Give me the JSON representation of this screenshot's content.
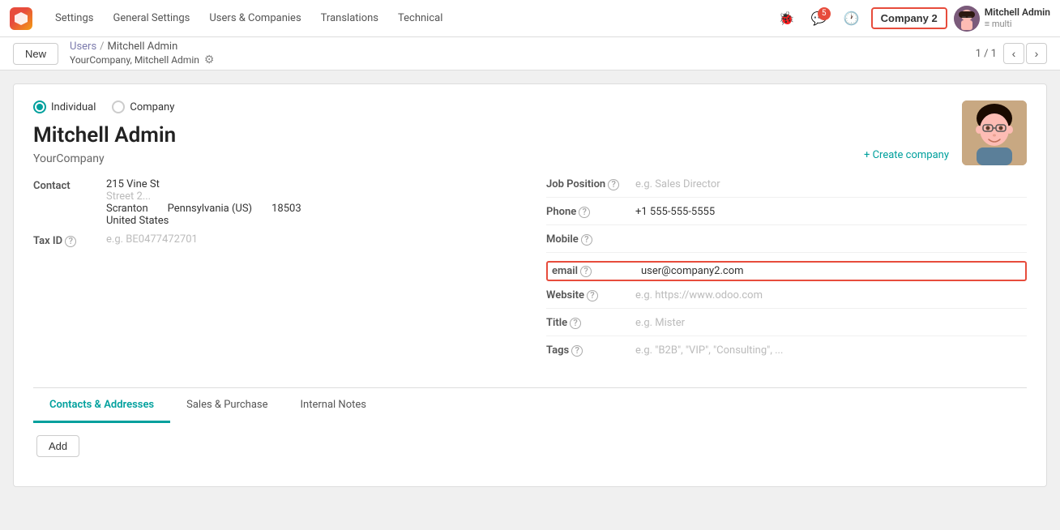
{
  "topbar": {
    "logo": "⬡",
    "nav_items": [
      "Settings",
      "General Settings",
      "Users & Companies",
      "Translations",
      "Technical"
    ],
    "icons": {
      "bug": "🐞",
      "chat_badge": "5",
      "clock": "🕐"
    },
    "company_label": "Company 2",
    "user_name": "Mitchell Admin",
    "user_sub": "≡ multi"
  },
  "breadcrumb": {
    "parent": "Users",
    "current": "Mitchell Admin",
    "subtitle": "YourCompany, Mitchell Admin",
    "pagination": "1 / 1"
  },
  "new_button": "New",
  "form": {
    "radio_individual": "Individual",
    "radio_company": "Company",
    "contact_name": "Mitchell Admin",
    "company_name": "YourCompany",
    "create_company": "+ Create company",
    "contact_label": "Contact",
    "address_line1": "215 Vine St",
    "address_line2_placeholder": "Street 2...",
    "address_city": "Scranton",
    "address_state": "Pennsylvania (US)",
    "address_zip": "18503",
    "address_country": "United States",
    "tax_id_label": "Tax ID",
    "tax_id_placeholder": "e.g. BE0477472701",
    "right_fields": [
      {
        "label": "Job Position",
        "value": "",
        "placeholder": "e.g. Sales Director",
        "has_help": true
      },
      {
        "label": "Phone",
        "value": "+1 555-555-5555",
        "placeholder": "",
        "has_help": true
      },
      {
        "label": "Mobile",
        "value": "",
        "placeholder": "",
        "has_help": true
      },
      {
        "label": "email",
        "value": "user@company2.com",
        "placeholder": "",
        "has_help": true,
        "highlighted": true
      },
      {
        "label": "Website",
        "value": "",
        "placeholder": "e.g. https://www.odoo.com",
        "has_help": true
      },
      {
        "label": "Title",
        "value": "",
        "placeholder": "e.g. Mister",
        "has_help": true
      },
      {
        "label": "Tags",
        "value": "",
        "placeholder": "e.g. \"B2B\", \"VIP\", \"Consulting\", ...",
        "has_help": true
      }
    ]
  },
  "tabs": [
    {
      "label": "Contacts & Addresses",
      "active": true
    },
    {
      "label": "Sales & Purchase",
      "active": false
    },
    {
      "label": "Internal Notes",
      "active": false
    }
  ],
  "add_button": "Add"
}
